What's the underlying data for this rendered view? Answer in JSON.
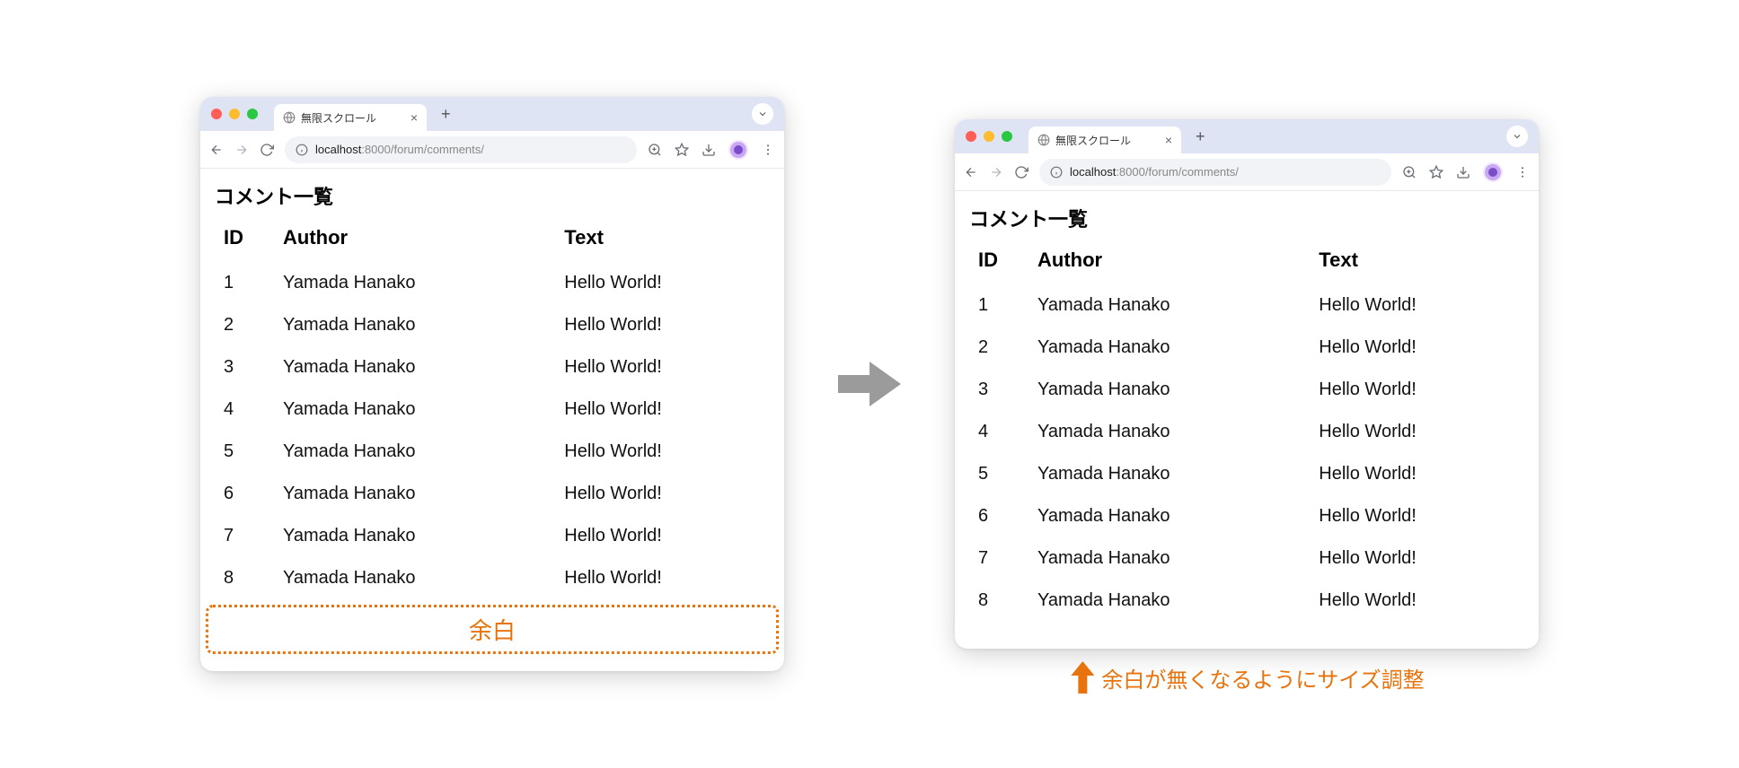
{
  "tab": {
    "title": "無限スクロール"
  },
  "address": {
    "host": "localhost",
    "port": ":8000",
    "path": "/forum/comments/"
  },
  "page": {
    "heading": "コメント一覧"
  },
  "table": {
    "headers": {
      "id": "ID",
      "author": "Author",
      "text": "Text"
    },
    "rows": [
      {
        "id": "1",
        "author": "Yamada Hanako",
        "text": "Hello World!"
      },
      {
        "id": "2",
        "author": "Yamada Hanako",
        "text": "Hello World!"
      },
      {
        "id": "3",
        "author": "Yamada Hanako",
        "text": "Hello World!"
      },
      {
        "id": "4",
        "author": "Yamada Hanako",
        "text": "Hello World!"
      },
      {
        "id": "5",
        "author": "Yamada Hanako",
        "text": "Hello World!"
      },
      {
        "id": "6",
        "author": "Yamada Hanako",
        "text": "Hello World!"
      },
      {
        "id": "7",
        "author": "Yamada Hanako",
        "text": "Hello World!"
      },
      {
        "id": "8",
        "author": "Yamada Hanako",
        "text": "Hello World!"
      }
    ]
  },
  "labels": {
    "margin": "余白",
    "annotation": "余白が無くなるようにサイズ調整"
  }
}
